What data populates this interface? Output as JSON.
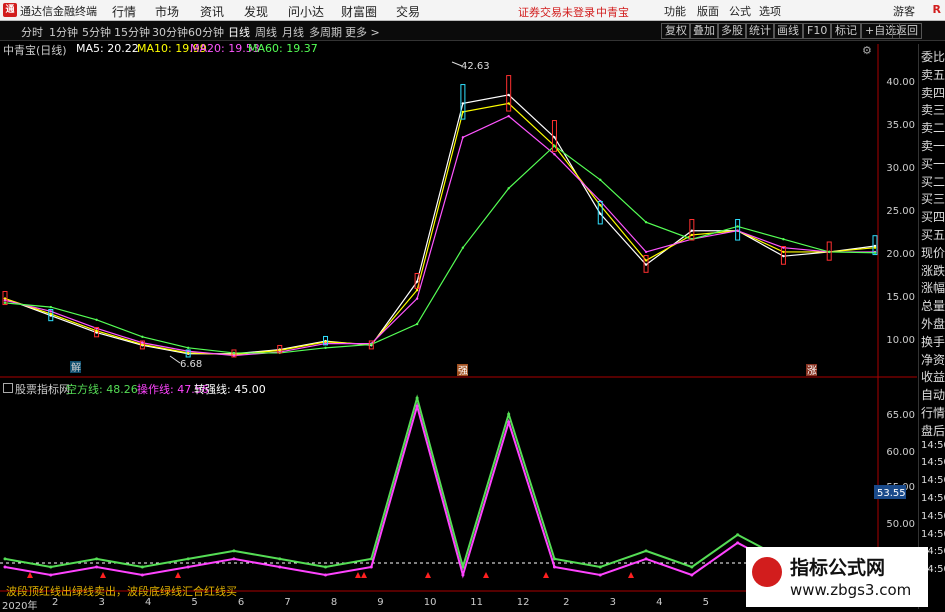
{
  "menubar": {
    "app_title": "通达信金融终端",
    "items": [
      "行情",
      "市场",
      "资讯",
      "发现",
      "问小达",
      "财富圈",
      "交易"
    ],
    "notice": "证券交易未登录",
    "stock": "中青宝",
    "right_items": [
      "功能",
      "版面",
      "公式",
      "选项"
    ],
    "guest": "游客",
    "badge": "R"
  },
  "toolbar": {
    "periods": [
      "分时",
      "1分钟",
      "5分钟",
      "15分钟",
      "30分钟",
      "60分钟",
      "日线",
      "周线",
      "月线",
      "多周期",
      "更多 >"
    ],
    "active_period": "日线",
    "buttons": [
      "复权",
      "叠加",
      "多股",
      "统计",
      "画线",
      "F10",
      "标记",
      "+自选",
      "返回"
    ],
    "gear_icon": "gear-icon"
  },
  "chart": {
    "stock_label": "中青宝(日线)",
    "ma": [
      {
        "label": "MA5: 20.22",
        "color": "#ffffff"
      },
      {
        "label": "MA10: 19.99",
        "color": "#ffff00"
      },
      {
        "label": "MA20: 19.53",
        "color": "#ff55ff"
      },
      {
        "label": "MA60: 19.37",
        "color": "#55ff55"
      }
    ],
    "high_label": "42.63",
    "low_label": "6.68",
    "marker_jie": "解",
    "marker_qiang": "强",
    "marker_zhang": "涨",
    "y_ticks": [
      "40.00",
      "35.00",
      "30.00",
      "25.00",
      "20.00",
      "15.00",
      "10.00"
    ]
  },
  "right_panel": [
    "委比",
    "卖五",
    "卖四",
    "卖三",
    "卖二",
    "卖一",
    "买一",
    "买二",
    "买三",
    "买四",
    "买五",
    "现价",
    "涨跌",
    "涨幅",
    "总量",
    "外盘",
    "换手",
    "净资",
    "收益",
    "自动",
    "行情",
    "盘后",
    "14:50",
    "14:50",
    "14:50",
    "14:50",
    "14:50",
    "14:50",
    "14:50",
    "14:50"
  ],
  "indicator": {
    "name": "股票指标网",
    "lines": [
      {
        "label": "空方线: 48.26",
        "color": "#55dd55"
      },
      {
        "label": "操作线: 47.56",
        "color": "#ff44ff"
      },
      {
        "label": "转强线: 45.00",
        "color": "#ffffff"
      }
    ],
    "y_ticks": [
      "65.00",
      "60.00",
      "55.00",
      "50.00"
    ],
    "current_value": "53.55",
    "hint": "波段顶红线出绿线卖出，波段底绿线汇合红线买"
  },
  "x_axis": {
    "year": "2020年",
    "months": [
      "2",
      "3",
      "4",
      "5",
      "6",
      "7",
      "8",
      "9",
      "10",
      "11",
      "12",
      "2",
      "3",
      "4",
      "5",
      "6",
      "7",
      "8"
    ]
  },
  "watermark": {
    "line1": "指标公式网",
    "line2": "www.zbgs3.com"
  },
  "chart_data": {
    "type": "line",
    "title": "中青宝(日线)",
    "ylim": [
      5,
      44
    ],
    "y_ticks": [
      10,
      15,
      20,
      25,
      30,
      35,
      40
    ],
    "series": [
      {
        "name": "MA5",
        "color": "#ffffff",
        "values": [
          14.0,
          12.0,
          10.0,
          8.5,
          7.5,
          7.5,
          8.0,
          9.0,
          8.5,
          16.0,
          37.0,
          38.0,
          33.0,
          24.0,
          18.0,
          22.0,
          22.0,
          19.0,
          19.5,
          20.2
        ]
      },
      {
        "name": "MA10",
        "color": "#ffff00",
        "values": [
          14.0,
          12.2,
          10.2,
          8.6,
          7.6,
          7.4,
          7.9,
          8.9,
          8.6,
          15.0,
          36.0,
          37.0,
          32.0,
          25.0,
          18.5,
          21.5,
          22.0,
          19.5,
          19.5,
          20.0
        ]
      },
      {
        "name": "MA20",
        "color": "#ff55ff",
        "values": [
          13.8,
          12.5,
          10.5,
          8.8,
          7.8,
          7.3,
          7.7,
          8.7,
          8.7,
          14.0,
          33.0,
          35.5,
          31.0,
          25.5,
          19.5,
          21.0,
          22.0,
          20.0,
          19.5,
          19.5
        ]
      },
      {
        "name": "MA60",
        "color": "#55ff55",
        "values": [
          13.5,
          13.0,
          11.5,
          9.5,
          8.2,
          7.6,
          7.6,
          8.2,
          8.6,
          11.0,
          20.0,
          27.0,
          32.0,
          28.0,
          23.0,
          21.0,
          22.5,
          21.0,
          19.5,
          19.4
        ]
      }
    ],
    "high": 42.63,
    "low": 6.68,
    "indicator": {
      "name": "股票指标网",
      "ylim": [
        45,
        68
      ],
      "threshold": 45.0,
      "series": [
        {
          "name": "空方线",
          "color": "#55dd55",
          "values": [
            47,
            46,
            47,
            46,
            47,
            48,
            47,
            46,
            47,
            67,
            46,
            65,
            47,
            46,
            48,
            46,
            50,
            47,
            46,
            48
          ]
        },
        {
          "name": "操作线",
          "color": "#ff44ff",
          "values": [
            46,
            45,
            46,
            45,
            46,
            47,
            46,
            45,
            46,
            66,
            45,
            64,
            46,
            45,
            47,
            45,
            49,
            46,
            45,
            47.5
          ]
        }
      ]
    }
  }
}
